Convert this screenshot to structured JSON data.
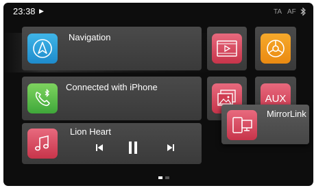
{
  "status": {
    "time": "23:38",
    "play_glyph": "▶",
    "ta": "TA",
    "af": "AF",
    "bluetooth_icon": "bluetooth-icon"
  },
  "tiles": {
    "navigation": {
      "label": "Navigation",
      "icon": "navigation-arrow-icon",
      "color": "#2a9fdc"
    },
    "phone": {
      "label": "Connected with iPhone",
      "icon": "bluetooth-phone-icon",
      "color": "#5bbf48"
    },
    "music": {
      "label": "Lion Heart",
      "icon": "music-note-icon",
      "color": "#d9475c",
      "controls": [
        "previous-track-icon",
        "pause-icon",
        "next-track-icon"
      ]
    },
    "video": {
      "icon": "video-film-icon",
      "color": "#d9475c"
    },
    "settings": {
      "icon": "settings-wheel-icon",
      "color": "#f29a1e"
    },
    "photo": {
      "icon": "photo-gallery-icon",
      "color": "#d9475c"
    },
    "aux": {
      "label": "AUX",
      "icon": "aux-icon",
      "color": "#d9475c"
    },
    "mirrorlink": {
      "label": "MirrorLink",
      "icon": "mirrorlink-devices-icon",
      "color": "#d9475c"
    }
  },
  "pager": {
    "pages": 2,
    "current": 1
  }
}
